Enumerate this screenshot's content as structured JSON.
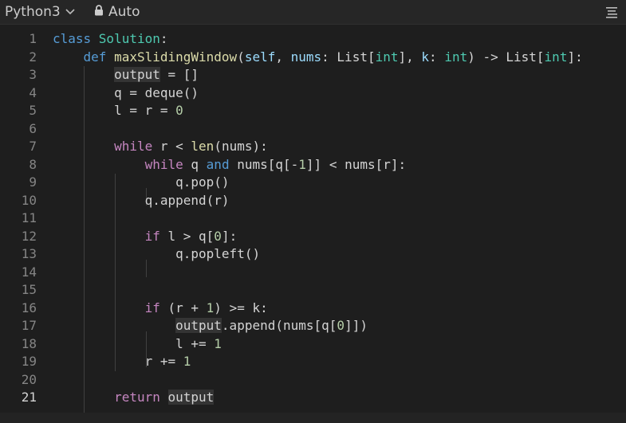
{
  "header": {
    "language": "Python3",
    "mode": "Auto"
  },
  "editor": {
    "active_line": 21,
    "lines": [
      {
        "n": "1",
        "tokens": [
          {
            "t": "class ",
            "c": "kw"
          },
          {
            "t": "Solution",
            "c": "cls"
          },
          {
            "t": ":",
            "c": ""
          }
        ]
      },
      {
        "n": "2",
        "tokens": [
          {
            "t": "    ",
            "c": ""
          },
          {
            "t": "def ",
            "c": "kw"
          },
          {
            "t": "maxSlidingWindow",
            "c": "fn"
          },
          {
            "t": "(",
            "c": ""
          },
          {
            "t": "self",
            "c": "par"
          },
          {
            "t": ", ",
            "c": ""
          },
          {
            "t": "nums",
            "c": "par"
          },
          {
            "t": ": List[",
            "c": ""
          },
          {
            "t": "int",
            "c": "cls"
          },
          {
            "t": "], ",
            "c": ""
          },
          {
            "t": "k",
            "c": "par"
          },
          {
            "t": ": ",
            "c": ""
          },
          {
            "t": "int",
            "c": "cls"
          },
          {
            "t": ") -> List[",
            "c": ""
          },
          {
            "t": "int",
            "c": "cls"
          },
          {
            "t": "]:",
            "c": ""
          }
        ]
      },
      {
        "n": "3",
        "tokens": [
          {
            "t": "        ",
            "c": ""
          },
          {
            "t": "output",
            "c": "hl"
          },
          {
            "t": " = []",
            "c": ""
          }
        ]
      },
      {
        "n": "4",
        "tokens": [
          {
            "t": "        q = deque()",
            "c": ""
          }
        ]
      },
      {
        "n": "5",
        "tokens": [
          {
            "t": "        l = r = ",
            "c": ""
          },
          {
            "t": "0",
            "c": "num"
          }
        ]
      },
      {
        "n": "6",
        "tokens": []
      },
      {
        "n": "7",
        "tokens": [
          {
            "t": "        ",
            "c": ""
          },
          {
            "t": "while",
            "c": "ctl"
          },
          {
            "t": " r < ",
            "c": ""
          },
          {
            "t": "len",
            "c": "fn"
          },
          {
            "t": "(nums):",
            "c": ""
          }
        ]
      },
      {
        "n": "8",
        "tokens": [
          {
            "t": "            ",
            "c": ""
          },
          {
            "t": "while",
            "c": "ctl"
          },
          {
            "t": " q ",
            "c": ""
          },
          {
            "t": "and",
            "c": "kw"
          },
          {
            "t": " nums[q[-",
            "c": ""
          },
          {
            "t": "1",
            "c": "num"
          },
          {
            "t": "]] < nums[r]:",
            "c": ""
          }
        ]
      },
      {
        "n": "9",
        "tokens": [
          {
            "t": "                q.pop()",
            "c": ""
          }
        ]
      },
      {
        "n": "10",
        "tokens": [
          {
            "t": "            q.append(r)",
            "c": ""
          }
        ]
      },
      {
        "n": "11",
        "tokens": []
      },
      {
        "n": "12",
        "tokens": [
          {
            "t": "            ",
            "c": ""
          },
          {
            "t": "if",
            "c": "ctl"
          },
          {
            "t": " l > q[",
            "c": ""
          },
          {
            "t": "0",
            "c": "num"
          },
          {
            "t": "]:",
            "c": ""
          }
        ]
      },
      {
        "n": "13",
        "tokens": [
          {
            "t": "                q.popleft()",
            "c": ""
          }
        ]
      },
      {
        "n": "14",
        "tokens": []
      },
      {
        "n": "15",
        "tokens": []
      },
      {
        "n": "16",
        "tokens": [
          {
            "t": "            ",
            "c": ""
          },
          {
            "t": "if",
            "c": "ctl"
          },
          {
            "t": " (r + ",
            "c": ""
          },
          {
            "t": "1",
            "c": "num"
          },
          {
            "t": ") >= k:",
            "c": ""
          }
        ]
      },
      {
        "n": "17",
        "tokens": [
          {
            "t": "                ",
            "c": ""
          },
          {
            "t": "output",
            "c": "hl"
          },
          {
            "t": ".append(nums[q[",
            "c": ""
          },
          {
            "t": "0",
            "c": "num"
          },
          {
            "t": "]])",
            "c": ""
          }
        ]
      },
      {
        "n": "18",
        "tokens": [
          {
            "t": "                l += ",
            "c": ""
          },
          {
            "t": "1",
            "c": "num"
          }
        ]
      },
      {
        "n": "19",
        "tokens": [
          {
            "t": "            r += ",
            "c": ""
          },
          {
            "t": "1",
            "c": "num"
          }
        ]
      },
      {
        "n": "20",
        "tokens": []
      },
      {
        "n": "21",
        "tokens": [
          {
            "t": "        ",
            "c": ""
          },
          {
            "t": "return",
            "c": "ctl"
          },
          {
            "t": " ",
            "c": ""
          },
          {
            "t": "output",
            "c": "hl"
          }
        ]
      }
    ]
  }
}
